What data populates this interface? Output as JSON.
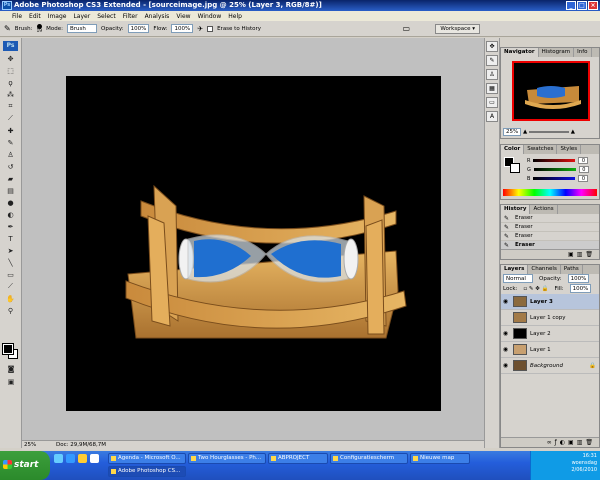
{
  "window": {
    "title": "Adobe Photoshop CS3 Extended - [sourceimage.jpg @ 25% (Layer 3, RGB/8#)]"
  },
  "menu": [
    "File",
    "Edit",
    "Image",
    "Layer",
    "Select",
    "Filter",
    "Analysis",
    "View",
    "Window",
    "Help"
  ],
  "options": {
    "brush_label": "Brush:",
    "brush_size": "19",
    "mode_label": "Mode:",
    "mode_value": "Brush",
    "opacity_label": "Opacity:",
    "opacity_value": "100%",
    "flow_label": "Flow:",
    "flow_value": "100%",
    "erase_history": "Erase to History",
    "workspace": "Workspace ▾"
  },
  "tools": {
    "logo": "Ps",
    "icons": [
      "move-icon",
      "marquee-icon",
      "lasso-icon",
      "magic-wand-icon",
      "crop-icon",
      "slice-icon",
      "healing-icon",
      "brush-icon",
      "stamp-icon",
      "history-brush-icon",
      "eraser-icon",
      "gradient-icon",
      "blur-icon",
      "dodge-icon",
      "pen-icon",
      "type-icon",
      "path-select-icon",
      "shape-icon",
      "notes-icon",
      "eyedropper-icon",
      "hand-icon",
      "zoom-icon"
    ]
  },
  "status": {
    "zoom": "25%",
    "doc": "Doc: 29,9M/68,7M"
  },
  "navigator": {
    "tabs": [
      "Navigator",
      "Histogram",
      "Info"
    ],
    "zoom": "25%"
  },
  "color": {
    "tabs": [
      "Color",
      "Swatches",
      "Styles"
    ],
    "channels": [
      {
        "label": "R",
        "value": "0",
        "color": "#e01010"
      },
      {
        "label": "G",
        "value": "0",
        "color": "#10b010"
      },
      {
        "label": "B",
        "value": "0",
        "color": "#1010e0"
      }
    ]
  },
  "history": {
    "tabs": [
      "History",
      "Actions"
    ],
    "items": [
      "Eraser",
      "Eraser",
      "Eraser",
      "Eraser"
    ]
  },
  "layers": {
    "tabs": [
      "Layers",
      "Channels",
      "Paths"
    ],
    "blend": "Normal",
    "opacity_label": "Opacity:",
    "opacity": "100%",
    "lock_label": "Lock:",
    "fill_label": "Fill:",
    "fill": "100%",
    "items": [
      {
        "name": "Layer 3",
        "selected": true,
        "visible": true,
        "thumb": "#8b6a3e"
      },
      {
        "name": "Layer 1 copy",
        "selected": false,
        "visible": false,
        "thumb": "#a27a48"
      },
      {
        "name": "Layer 2",
        "selected": false,
        "visible": true,
        "thumb": "#000000"
      },
      {
        "name": "Layer 1",
        "selected": false,
        "visible": true,
        "thumb": "#c8a070"
      },
      {
        "name": "Background",
        "selected": false,
        "visible": true,
        "thumb": "#6d5030"
      }
    ]
  },
  "taskbar": {
    "start": "start",
    "tasks": [
      "Agenda - Microsoft O...",
      "Two Hourglasses - Ph...",
      "ABPROJECT",
      "Configuratiescherm",
      "Nieuwe map",
      "Adobe Photoshop CS..."
    ],
    "time": "16:31",
    "day": "woensdag",
    "date": "2/06/2010"
  }
}
